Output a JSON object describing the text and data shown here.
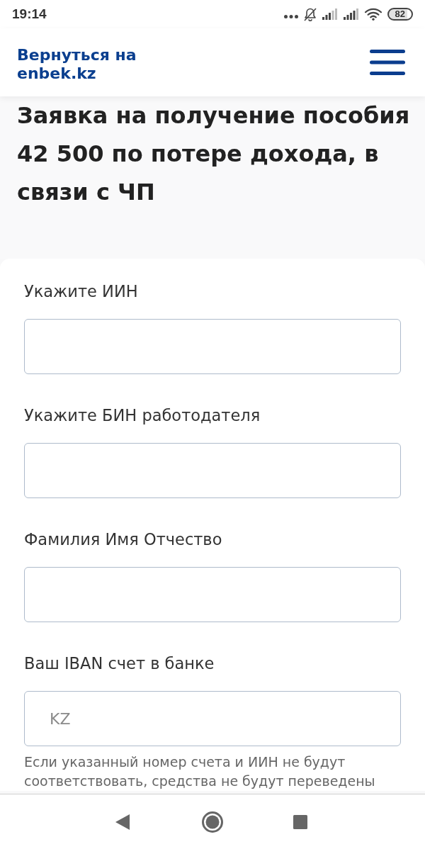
{
  "status_bar": {
    "time": "19:14",
    "battery": "82"
  },
  "header": {
    "back_link": "Вернуться на enbek.kz"
  },
  "page_title": "Заявка на получение пособия 42 500 по потере дохода, в связи с ЧП",
  "form": {
    "fields": [
      {
        "label": "Укажите ИИН"
      },
      {
        "label": "Укажите БИН работодателя"
      },
      {
        "label": "Фамилия Имя Отчество"
      },
      {
        "label": "Ваш IBAN счет в банке",
        "placeholder": "KZ",
        "hint": "Если указанный номер счета и ИИН не будут соответствовать, средства не будут переведены"
      }
    ]
  }
}
